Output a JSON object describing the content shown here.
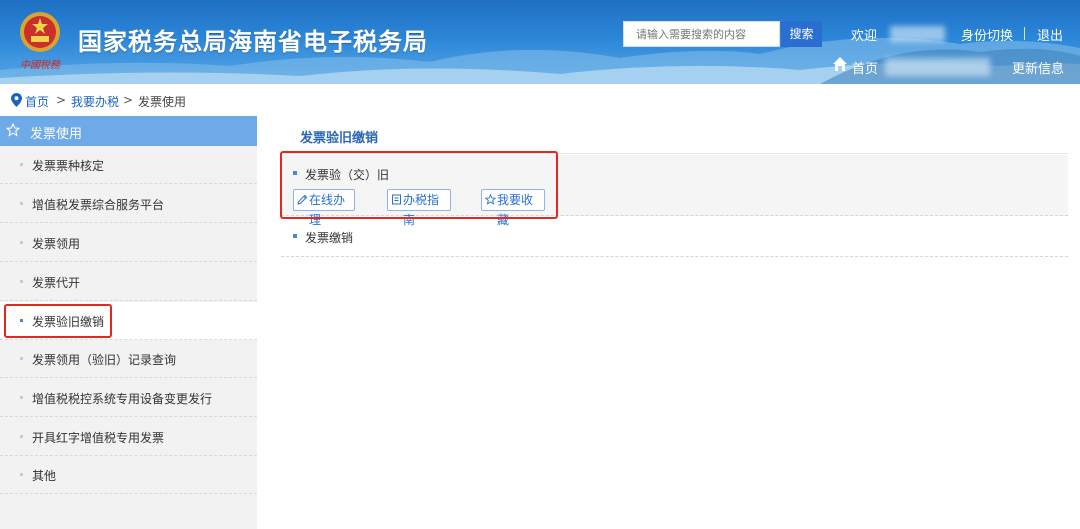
{
  "header": {
    "site_title": "国家税务总局海南省电子税务局",
    "emblem_script": "中國稅務",
    "search_placeholder": "请输入需要搜索的内容",
    "search_button": "搜索",
    "welcome": "欢迎",
    "switch_identity": "身份切换",
    "logout": "退出",
    "home": "首页",
    "update_info": "更新信息"
  },
  "breadcrumb": {
    "items": [
      "首页",
      "我要办税",
      "发票使用"
    ],
    "separator": ">"
  },
  "sidebar": {
    "title": "发票使用",
    "items": [
      {
        "label": "发票票种核定"
      },
      {
        "label": "增值税发票综合服务平台"
      },
      {
        "label": "发票领用"
      },
      {
        "label": "发票代开"
      },
      {
        "label": "发票验旧缴销",
        "active": true
      },
      {
        "label": "发票领用（验旧）记录查询"
      },
      {
        "label": "增值税税控系统专用设备变更发行"
      },
      {
        "label": "开具红字增值税专用发票"
      },
      {
        "label": "其他"
      }
    ]
  },
  "main": {
    "title": "发票验旧缴销",
    "services": [
      {
        "label": "发票验（交）旧",
        "actions": [
          "在线办理",
          "办税指南",
          "我要收藏"
        ]
      },
      {
        "label": "发票缴销"
      }
    ]
  },
  "colors": {
    "header_blue": "#2b86d8",
    "sidebar_head": "#6ea9e8",
    "link_blue": "#1c63c0",
    "highlight_red": "#e5281e"
  }
}
